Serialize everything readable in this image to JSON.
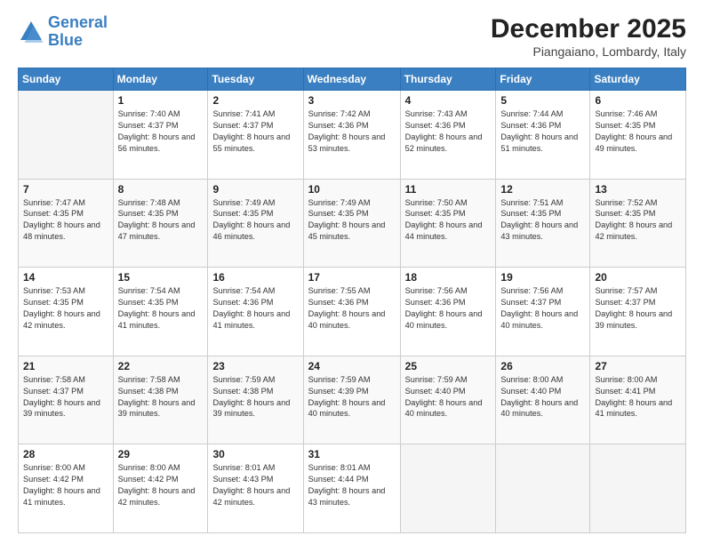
{
  "logo": {
    "line1": "General",
    "line2": "Blue"
  },
  "title": "December 2025",
  "location": "Piangaiano, Lombardy, Italy",
  "days_of_week": [
    "Sunday",
    "Monday",
    "Tuesday",
    "Wednesday",
    "Thursday",
    "Friday",
    "Saturday"
  ],
  "weeks": [
    [
      {
        "day": "",
        "empty": true
      },
      {
        "day": "1",
        "sunrise": "7:40 AM",
        "sunset": "4:37 PM",
        "daylight": "8 hours and 56 minutes."
      },
      {
        "day": "2",
        "sunrise": "7:41 AM",
        "sunset": "4:37 PM",
        "daylight": "8 hours and 55 minutes."
      },
      {
        "day": "3",
        "sunrise": "7:42 AM",
        "sunset": "4:36 PM",
        "daylight": "8 hours and 53 minutes."
      },
      {
        "day": "4",
        "sunrise": "7:43 AM",
        "sunset": "4:36 PM",
        "daylight": "8 hours and 52 minutes."
      },
      {
        "day": "5",
        "sunrise": "7:44 AM",
        "sunset": "4:36 PM",
        "daylight": "8 hours and 51 minutes."
      },
      {
        "day": "6",
        "sunrise": "7:46 AM",
        "sunset": "4:35 PM",
        "daylight": "8 hours and 49 minutes."
      }
    ],
    [
      {
        "day": "7",
        "sunrise": "7:47 AM",
        "sunset": "4:35 PM",
        "daylight": "8 hours and 48 minutes."
      },
      {
        "day": "8",
        "sunrise": "7:48 AM",
        "sunset": "4:35 PM",
        "daylight": "8 hours and 47 minutes."
      },
      {
        "day": "9",
        "sunrise": "7:49 AM",
        "sunset": "4:35 PM",
        "daylight": "8 hours and 46 minutes."
      },
      {
        "day": "10",
        "sunrise": "7:49 AM",
        "sunset": "4:35 PM",
        "daylight": "8 hours and 45 minutes."
      },
      {
        "day": "11",
        "sunrise": "7:50 AM",
        "sunset": "4:35 PM",
        "daylight": "8 hours and 44 minutes."
      },
      {
        "day": "12",
        "sunrise": "7:51 AM",
        "sunset": "4:35 PM",
        "daylight": "8 hours and 43 minutes."
      },
      {
        "day": "13",
        "sunrise": "7:52 AM",
        "sunset": "4:35 PM",
        "daylight": "8 hours and 42 minutes."
      }
    ],
    [
      {
        "day": "14",
        "sunrise": "7:53 AM",
        "sunset": "4:35 PM",
        "daylight": "8 hours and 42 minutes."
      },
      {
        "day": "15",
        "sunrise": "7:54 AM",
        "sunset": "4:35 PM",
        "daylight": "8 hours and 41 minutes."
      },
      {
        "day": "16",
        "sunrise": "7:54 AM",
        "sunset": "4:36 PM",
        "daylight": "8 hours and 41 minutes."
      },
      {
        "day": "17",
        "sunrise": "7:55 AM",
        "sunset": "4:36 PM",
        "daylight": "8 hours and 40 minutes."
      },
      {
        "day": "18",
        "sunrise": "7:56 AM",
        "sunset": "4:36 PM",
        "daylight": "8 hours and 40 minutes."
      },
      {
        "day": "19",
        "sunrise": "7:56 AM",
        "sunset": "4:37 PM",
        "daylight": "8 hours and 40 minutes."
      },
      {
        "day": "20",
        "sunrise": "7:57 AM",
        "sunset": "4:37 PM",
        "daylight": "8 hours and 39 minutes."
      }
    ],
    [
      {
        "day": "21",
        "sunrise": "7:58 AM",
        "sunset": "4:37 PM",
        "daylight": "8 hours and 39 minutes."
      },
      {
        "day": "22",
        "sunrise": "7:58 AM",
        "sunset": "4:38 PM",
        "daylight": "8 hours and 39 minutes."
      },
      {
        "day": "23",
        "sunrise": "7:59 AM",
        "sunset": "4:38 PM",
        "daylight": "8 hours and 39 minutes."
      },
      {
        "day": "24",
        "sunrise": "7:59 AM",
        "sunset": "4:39 PM",
        "daylight": "8 hours and 40 minutes."
      },
      {
        "day": "25",
        "sunrise": "7:59 AM",
        "sunset": "4:40 PM",
        "daylight": "8 hours and 40 minutes."
      },
      {
        "day": "26",
        "sunrise": "8:00 AM",
        "sunset": "4:40 PM",
        "daylight": "8 hours and 40 minutes."
      },
      {
        "day": "27",
        "sunrise": "8:00 AM",
        "sunset": "4:41 PM",
        "daylight": "8 hours and 41 minutes."
      }
    ],
    [
      {
        "day": "28",
        "sunrise": "8:00 AM",
        "sunset": "4:42 PM",
        "daylight": "8 hours and 41 minutes."
      },
      {
        "day": "29",
        "sunrise": "8:00 AM",
        "sunset": "4:42 PM",
        "daylight": "8 hours and 42 minutes."
      },
      {
        "day": "30",
        "sunrise": "8:01 AM",
        "sunset": "4:43 PM",
        "daylight": "8 hours and 42 minutes."
      },
      {
        "day": "31",
        "sunrise": "8:01 AM",
        "sunset": "4:44 PM",
        "daylight": "8 hours and 43 minutes."
      },
      {
        "day": "",
        "empty": true
      },
      {
        "day": "",
        "empty": true
      },
      {
        "day": "",
        "empty": true
      }
    ]
  ]
}
